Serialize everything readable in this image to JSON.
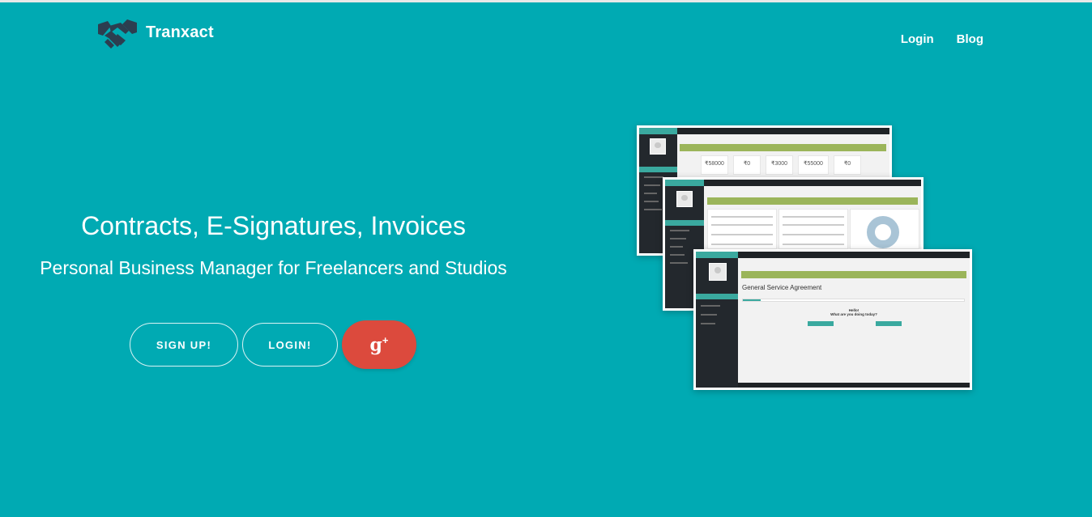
{
  "brand": {
    "name": "Tranxact",
    "icon": "handshake-icon"
  },
  "nav": {
    "login": "Login",
    "blog": "Blog"
  },
  "hero": {
    "title": "Contracts, E-Signatures, Invoices",
    "subtitle": "Personal Business Manager for Freelancers and Studios"
  },
  "buttons": {
    "signup": "SIGN UP!",
    "login": "LOGIN!",
    "google": "g",
    "google_plus": "+"
  },
  "preview": {
    "dashboard": {
      "stats": [
        {
          "value": "₹58000"
        },
        {
          "value": "₹0"
        },
        {
          "value": "₹3000"
        },
        {
          "value": "₹55000"
        },
        {
          "value": "₹0"
        }
      ]
    },
    "contract": {
      "title": "General Service Agreement",
      "greeting": "Hello!",
      "question": "What are you doing today?"
    }
  },
  "colors": {
    "background": "#00aab3",
    "google": "#dc4a3d",
    "accent": "#3aa99f",
    "banner": "#9bb55a",
    "sidebar": "#23282d"
  }
}
